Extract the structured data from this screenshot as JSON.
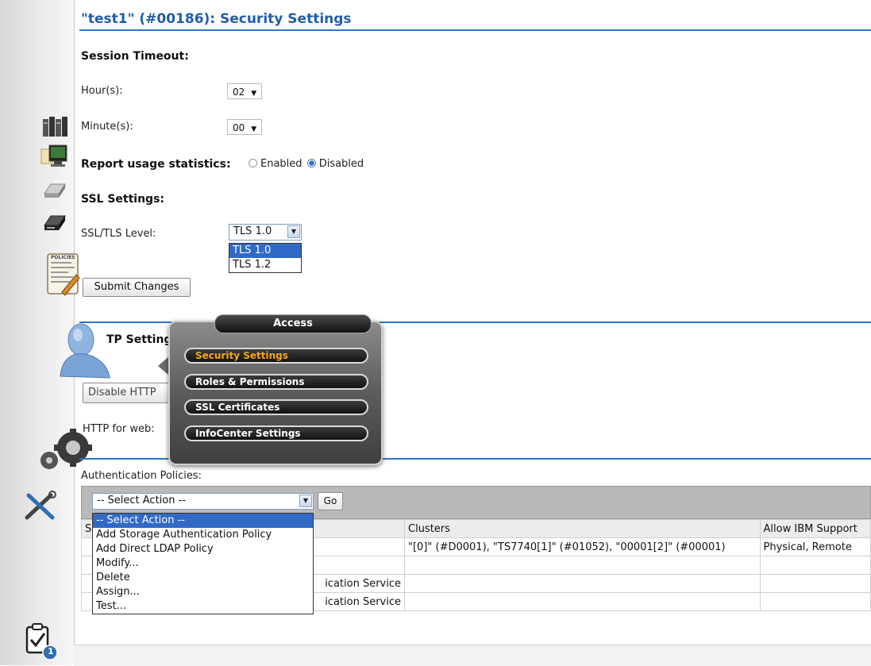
{
  "page": {
    "title": "\"test1\" (#00186): Security Settings"
  },
  "session": {
    "heading": "Session Timeout:",
    "hours_label": "Hour(s):",
    "hours_value": "02",
    "minutes_label": "Minute(s):",
    "minutes_value": "00"
  },
  "usage": {
    "label": "Report usage statistics:",
    "enabled_label": "Enabled",
    "disabled_label": "Disabled",
    "selected": "Disabled"
  },
  "ssl": {
    "heading": "SSL Settings:",
    "level_label": "SSL/TLS Level:",
    "level_value": "TLS 1.0",
    "options": [
      "TLS 1.0",
      "TLS 1.2"
    ],
    "submit_label": "Submit Changes"
  },
  "http": {
    "heading_partial": "TP Settings:",
    "disable_button_partial": "Disable HTTP",
    "web_label": "HTTP for web:"
  },
  "access_popup": {
    "title": "Access",
    "items": [
      "Security Settings",
      "Roles & Permissions",
      "SSL Certificates",
      "InfoCenter Settings"
    ],
    "active": "Security Settings"
  },
  "auth": {
    "label": "Authentication Policies:",
    "action_value": "-- Select Action --",
    "go_label": "Go",
    "actions": [
      "-- Select Action --",
      "Add Storage Authentication Policy",
      "Add Direct LDAP Policy",
      "Modify...",
      "Delete",
      "Assign...",
      "Test..."
    ],
    "columns": {
      "first_partial": "S",
      "clusters": "Clusters",
      "allow_ibm_support": "Allow IBM Support"
    },
    "rows": [
      {
        "type": "",
        "clusters": "\"[0]\" (#D0001), \"TS7740[1]\" (#01052), \"00001[2]\" (#00001)",
        "support": "Physical, Remote"
      },
      {
        "type": "",
        "clusters": "",
        "support": ""
      },
      {
        "type": "ication Service",
        "clusters": "",
        "support": ""
      },
      {
        "type": "ication Service",
        "clusters": "",
        "support": ""
      }
    ]
  },
  "nav": {
    "icons": [
      "servers-icon",
      "monitor-icon",
      "drive-icon",
      "tape-drive-icon",
      "policies-icon",
      "user-icon",
      "gears-icon",
      "tools-icon",
      "tasks-icon"
    ],
    "policies_text": "POLICIES",
    "tasks_badge": "1"
  },
  "colors": {
    "title_blue": "#1e5da8",
    "rule_blue": "#2f75c9",
    "select_highlight": "#3169c6",
    "active_item": "#f7a51c"
  }
}
